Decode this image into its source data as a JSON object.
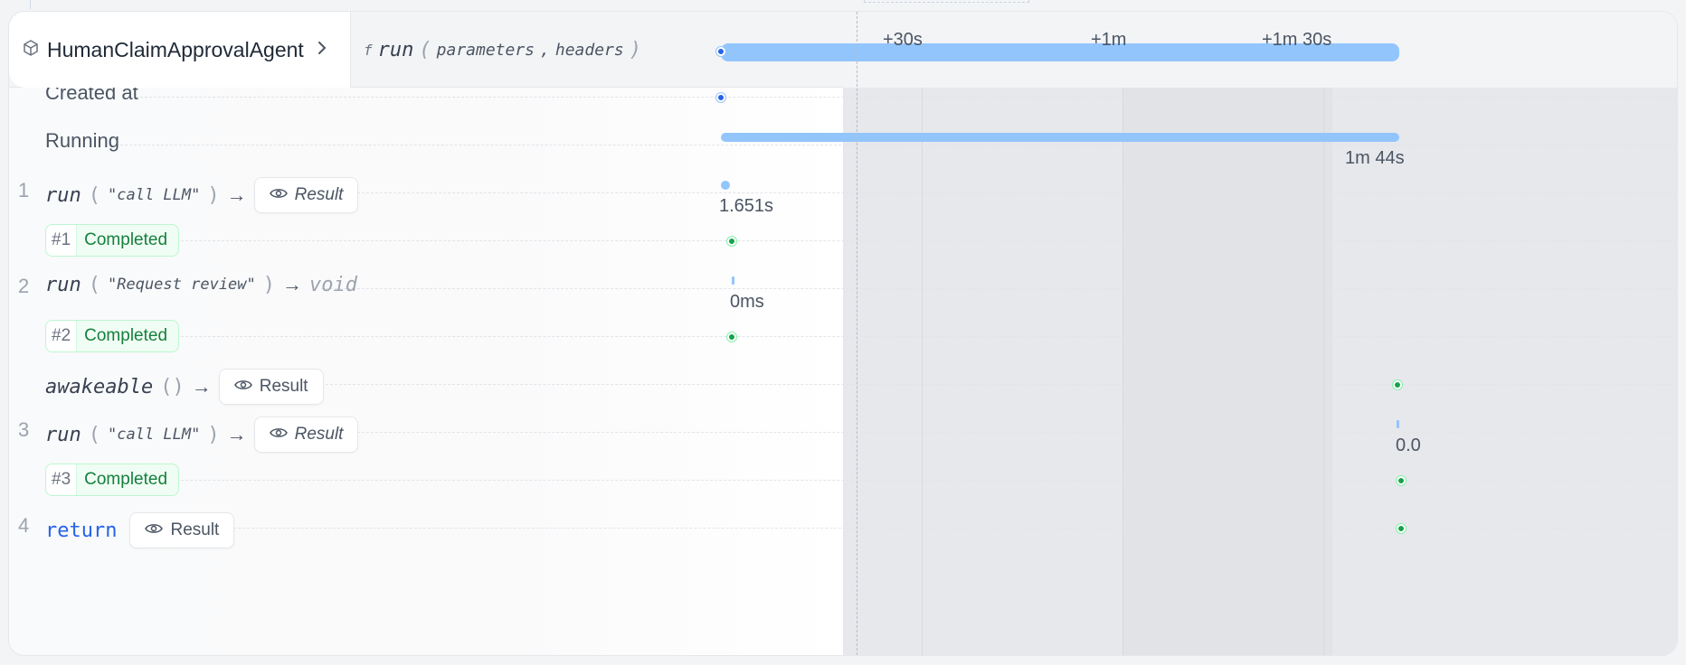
{
  "header": {
    "agent_name": "HumanClaimApprovalAgent",
    "fn_marker": "f",
    "fn_name": "run",
    "params": [
      "parameters",
      "headers"
    ],
    "comma": ",",
    "open_paren": "(",
    "close_paren": ")"
  },
  "timeline": {
    "ticks": [
      "+30s",
      "+1m",
      "+1m 30s"
    ],
    "total_duration": "1m 44s",
    "step1_duration": "1.651s",
    "step2_duration": "0ms",
    "step3_duration": "0.0"
  },
  "rows": {
    "created_at": "Created at",
    "running": "Running",
    "step1": {
      "num": "1",
      "fn": "run",
      "arg": "\"call LLM\"",
      "result": "Result"
    },
    "attempt1": {
      "num": "#1",
      "status": "Completed"
    },
    "step2": {
      "num": "2",
      "fn": "run",
      "arg": "\"Request review\"",
      "void": "void"
    },
    "attempt2": {
      "num": "#2",
      "status": "Completed"
    },
    "awakeable": {
      "fn": "awakeable",
      "parens": "()",
      "result": "Result"
    },
    "step3": {
      "num": "3",
      "fn": "run",
      "arg": "\"call LLM\"",
      "result": "Result"
    },
    "attempt3": {
      "num": "#3",
      "status": "Completed"
    },
    "step4": {
      "num": "4",
      "ret": "return",
      "result": "Result"
    }
  },
  "symbols": {
    "arrow": "→",
    "chevron": "›",
    "lparen": "(",
    "rparen": ")"
  },
  "colors": {
    "bar": "#93c5fd",
    "accent_blue": "#2563eb",
    "success": "#15803d",
    "success_dot": "#16a34a"
  }
}
